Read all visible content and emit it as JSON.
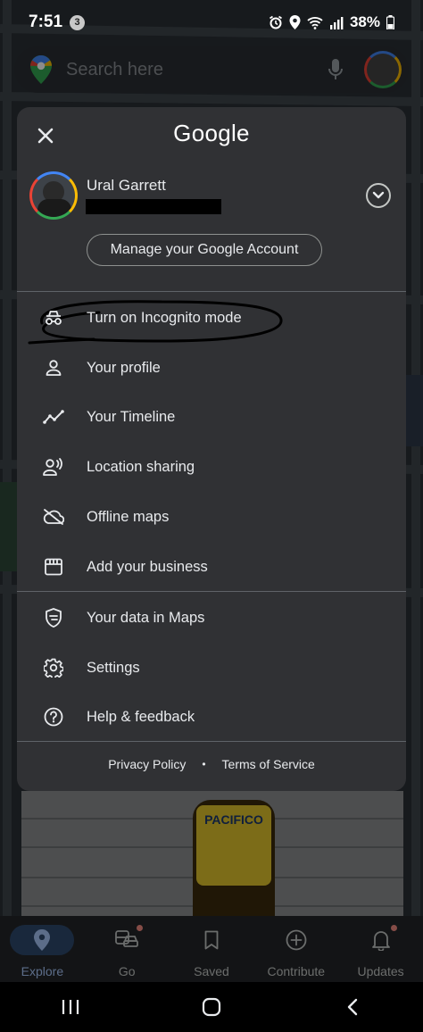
{
  "status_bar": {
    "time": "7:51",
    "notification_count": "3",
    "battery": "38%"
  },
  "search": {
    "placeholder": "Search here"
  },
  "panel": {
    "logo_text": "Google",
    "account": {
      "name": "Ural Garrett",
      "manage_label": "Manage your Google Account"
    },
    "menu_items": [
      {
        "label": "Turn on Incognito mode",
        "icon": "incognito-icon"
      },
      {
        "label": "Your profile",
        "icon": "profile-icon"
      },
      {
        "label": "Your Timeline",
        "icon": "timeline-icon"
      },
      {
        "label": "Location sharing",
        "icon": "location-sharing-icon"
      },
      {
        "label": "Offline maps",
        "icon": "offline-maps-icon"
      },
      {
        "label": "Add your business",
        "icon": "storefront-icon"
      },
      {
        "label": "Your data in Maps",
        "icon": "shield-icon"
      },
      {
        "label": "Settings",
        "icon": "gear-icon"
      },
      {
        "label": "Help & feedback",
        "icon": "help-icon"
      }
    ],
    "footer": {
      "privacy": "Privacy Policy",
      "separator": "•",
      "terms": "Terms of Service"
    }
  },
  "photo_label": "PACIFICO",
  "bottom_nav": [
    {
      "label": "Explore",
      "icon": "location-pin-icon",
      "active": true
    },
    {
      "label": "Go",
      "icon": "commute-icon",
      "active": false
    },
    {
      "label": "Saved",
      "icon": "bookmark-icon",
      "active": false
    },
    {
      "label": "Contribute",
      "icon": "add-circle-icon",
      "active": false
    },
    {
      "label": "Updates",
      "icon": "bell-icon",
      "active": false
    }
  ],
  "colors": {
    "panel_bg": "#303134",
    "accent": "#a8c7fa",
    "active_nav_bg": "#2f4a6e",
    "notification_dot": "#f28b82"
  }
}
